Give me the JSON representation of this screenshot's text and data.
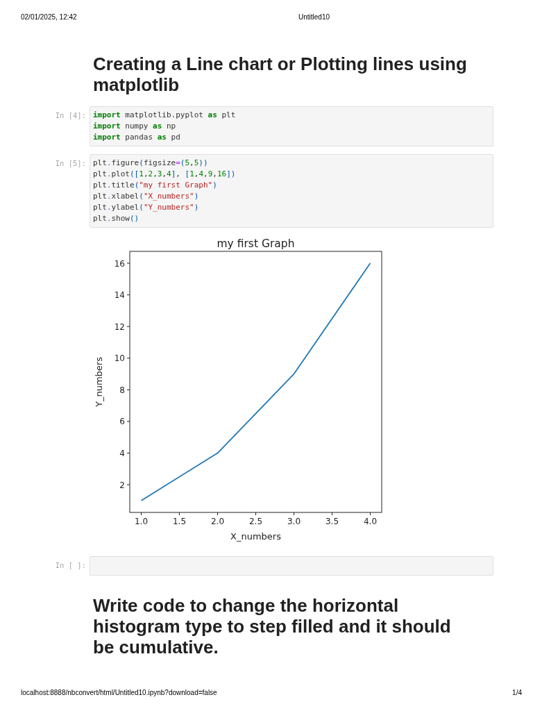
{
  "print_header": {
    "date_time": "02/01/2025, 12:42",
    "title": "Untitled10"
  },
  "cells": [
    {
      "kind": "markdown",
      "heading": "Creating a Line chart or Plotting lines using matplotlib"
    },
    {
      "kind": "code",
      "prompt": "In [4]:",
      "lines": [
        [
          {
            "kind": "keyword",
            "text": "import"
          },
          {
            "kind": "text",
            "text": " matplotlib.pyplot "
          },
          {
            "kind": "keyword",
            "text": "as"
          },
          {
            "kind": "text",
            "text": " plt"
          }
        ],
        [
          {
            "kind": "keyword",
            "text": "import"
          },
          {
            "kind": "text",
            "text": " numpy "
          },
          {
            "kind": "keyword",
            "text": "as"
          },
          {
            "kind": "text",
            "text": " np"
          }
        ],
        [
          {
            "kind": "keyword",
            "text": "import"
          },
          {
            "kind": "text",
            "text": " pandas "
          },
          {
            "kind": "keyword",
            "text": "as"
          },
          {
            "kind": "text",
            "text": " pd"
          }
        ]
      ]
    },
    {
      "kind": "code",
      "prompt": "In [5]:",
      "lines": [
        [
          {
            "kind": "text",
            "text": "plt"
          },
          {
            "kind": "operator",
            "text": "."
          },
          {
            "kind": "text",
            "text": "figure"
          },
          {
            "kind": "bracket",
            "text": "("
          },
          {
            "kind": "text",
            "text": "figsize"
          },
          {
            "kind": "operator",
            "text": "="
          },
          {
            "kind": "bracket",
            "text": "("
          },
          {
            "kind": "number",
            "text": "5"
          },
          {
            "kind": "text",
            "text": ","
          },
          {
            "kind": "number",
            "text": "5"
          },
          {
            "kind": "bracket",
            "text": "))"
          }
        ],
        [
          {
            "kind": "text",
            "text": "plt"
          },
          {
            "kind": "operator",
            "text": "."
          },
          {
            "kind": "text",
            "text": "plot"
          },
          {
            "kind": "bracket",
            "text": "(["
          },
          {
            "kind": "number",
            "text": "1"
          },
          {
            "kind": "text",
            "text": ","
          },
          {
            "kind": "number",
            "text": "2"
          },
          {
            "kind": "text",
            "text": ","
          },
          {
            "kind": "number",
            "text": "3"
          },
          {
            "kind": "text",
            "text": ","
          },
          {
            "kind": "number",
            "text": "4"
          },
          {
            "kind": "bracket",
            "text": "]"
          },
          {
            "kind": "text",
            "text": ", "
          },
          {
            "kind": "bracket",
            "text": "["
          },
          {
            "kind": "number",
            "text": "1"
          },
          {
            "kind": "text",
            "text": ","
          },
          {
            "kind": "number",
            "text": "4"
          },
          {
            "kind": "text",
            "text": ","
          },
          {
            "kind": "number",
            "text": "9"
          },
          {
            "kind": "text",
            "text": ","
          },
          {
            "kind": "number",
            "text": "16"
          },
          {
            "kind": "bracket",
            "text": "])"
          }
        ],
        [
          {
            "kind": "text",
            "text": "plt"
          },
          {
            "kind": "operator",
            "text": "."
          },
          {
            "kind": "text",
            "text": "title"
          },
          {
            "kind": "bracket",
            "text": "("
          },
          {
            "kind": "string",
            "text": "\"my first Graph\""
          },
          {
            "kind": "bracket",
            "text": ")"
          }
        ],
        [
          {
            "kind": "text",
            "text": "plt"
          },
          {
            "kind": "operator",
            "text": "."
          },
          {
            "kind": "text",
            "text": "xlabel"
          },
          {
            "kind": "bracket",
            "text": "("
          },
          {
            "kind": "string",
            "text": "\"X_numbers\""
          },
          {
            "kind": "bracket",
            "text": ")"
          }
        ],
        [
          {
            "kind": "text",
            "text": "plt"
          },
          {
            "kind": "operator",
            "text": "."
          },
          {
            "kind": "text",
            "text": "ylabel"
          },
          {
            "kind": "bracket",
            "text": "("
          },
          {
            "kind": "string",
            "text": "\"Y_numbers\""
          },
          {
            "kind": "bracket",
            "text": ")"
          }
        ],
        [
          {
            "kind": "text",
            "text": "plt"
          },
          {
            "kind": "operator",
            "text": "."
          },
          {
            "kind": "text",
            "text": "show"
          },
          {
            "kind": "bracket",
            "text": "()"
          }
        ]
      ],
      "output": {
        "chart_data": {
          "type": "line",
          "title": "my first Graph",
          "xlabel": "X_numbers",
          "ylabel": "Y_numbers",
          "x": [
            1,
            2,
            3,
            4
          ],
          "series": [
            {
              "color": "#1f77b4",
              "values": [
                1,
                4,
                9,
                16
              ]
            }
          ],
          "xlim": [
            0.85,
            4.15
          ],
          "ylim": [
            0.25,
            16.75
          ],
          "xticks": [
            {
              "value": 1,
              "label": "1.0"
            },
            {
              "value": 1.5,
              "label": "1.5"
            },
            {
              "value": 2,
              "label": "2.0"
            },
            {
              "value": 2.5,
              "label": "2.5"
            },
            {
              "value": 3,
              "label": "3.0"
            },
            {
              "value": 3.5,
              "label": "3.5"
            },
            {
              "value": 4,
              "label": "4.0"
            }
          ],
          "yticks": [
            2,
            4,
            6,
            8,
            10,
            12,
            14,
            16
          ]
        }
      }
    },
    {
      "kind": "code",
      "prompt": "In [ ]:"
    },
    {
      "kind": "markdown",
      "heading": "Write code to change the horizontal histogram type to step filled and it should be cumulative."
    }
  ],
  "print_footer": {
    "url": "localhost:8888/nbconvert/html/Untitled10.ipynb?download=false",
    "page": "1/4"
  }
}
